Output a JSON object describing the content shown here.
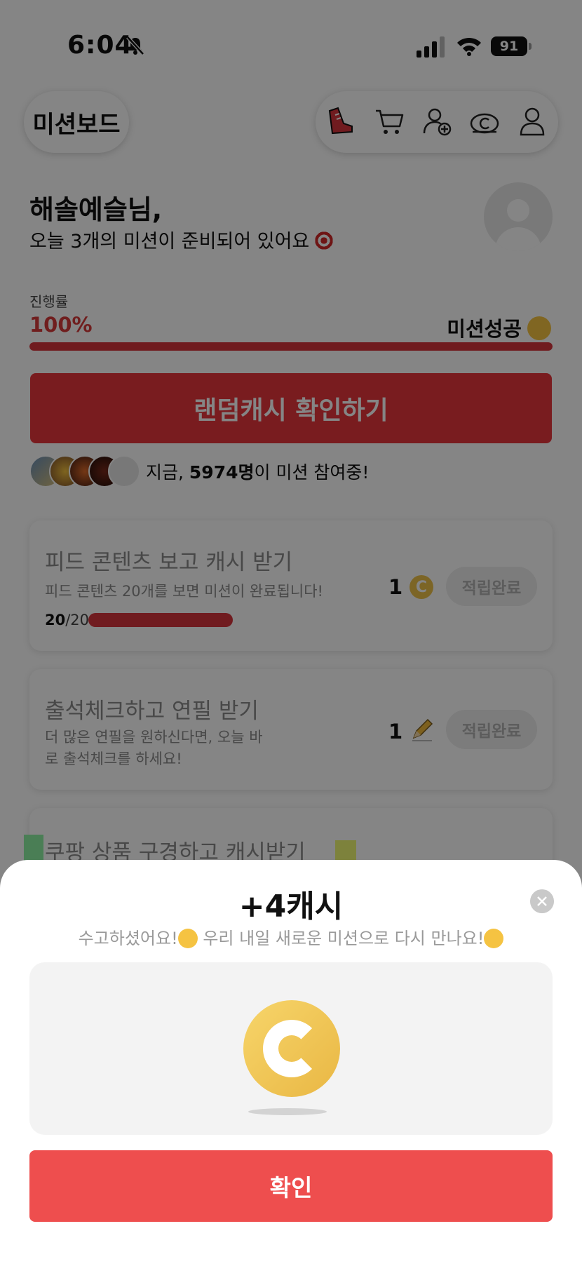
{
  "status_bar": {
    "time": "6:04",
    "battery": "91"
  },
  "header": {
    "board_label": "미션보드"
  },
  "greeting": {
    "name": "해솔예슬님,",
    "subtitle": "오늘 3개의 미션이 준비되어 있어요"
  },
  "progress": {
    "label": "진행률",
    "value_text": "100%",
    "value": 100,
    "success_label": "미션성공"
  },
  "random_cash_button": "랜덤캐시 확인하기",
  "participants": {
    "prefix": "지금, ",
    "count": "5974명",
    "suffix": "이 미션 참여중!"
  },
  "missions": [
    {
      "title": "피드 콘텐츠 보고 캐시 받기",
      "desc": "피드 콘텐츠 20개를 보면 미션이 완료됩니다!",
      "amount": "1",
      "reward_icon": "coin-icon",
      "status": "적립완료",
      "progress_done": "20",
      "progress_total": "/20"
    },
    {
      "title": "출석체크하고 연필 받기",
      "desc": "더 많은 연필을 원하신다면, 오늘 바로 출석체크를 하세요!",
      "amount": "1",
      "reward_icon": "pencil-icon",
      "status": "적립완료"
    },
    {
      "title": "쿠팡 상품 구경하고 캐시받기"
    }
  ],
  "sheet": {
    "title": "+4캐시",
    "subtitle_a": "수고하셨어요!",
    "subtitle_b": " 우리 내일 새로운 미션으로 다시 만나요!",
    "confirm": "확인"
  },
  "colors": {
    "accent": "#e8373d",
    "confirm": "#ee4e4e",
    "coin": "#eec14a"
  }
}
